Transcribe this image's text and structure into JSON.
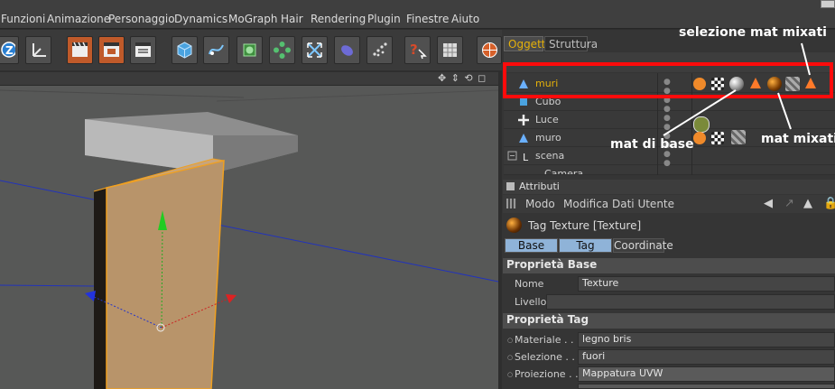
{
  "menu": {
    "items": [
      "Funzioni",
      "Animazione",
      "Personaggio",
      "Dynamics",
      "MoGraph",
      "Hair",
      "Rendering",
      "Plugin",
      "Finestre",
      "Aiuto"
    ]
  },
  "toolbar": {
    "icons": [
      "z-mode-icon",
      "axis-icon",
      "render-view-icon",
      "render-picture-icon",
      "render-settings-icon",
      "cube-icon",
      "spline-pen-icon",
      "nurbs-icon",
      "array-icon",
      "deformer-icon",
      "scene-icon",
      "particle-icon",
      "help-pointer-icon",
      "ruler-icon",
      "sphere-icon"
    ]
  },
  "object_manager": {
    "tabs": [
      "Oggetti",
      "Struttura"
    ],
    "rows": [
      {
        "name": "muri",
        "highlight": true
      },
      {
        "name": "Cubo",
        "highlight": false
      },
      {
        "name": "Luce",
        "highlight": false
      },
      {
        "name": "muro",
        "highlight": false
      },
      {
        "name": "scena",
        "highlight": false
      },
      {
        "name": "Camera",
        "highlight": false
      }
    ]
  },
  "attributes": {
    "header": "Attributi",
    "menu": [
      "Modo",
      "Modifica",
      "Dati Utente"
    ],
    "title": "Tag Texture [Texture]",
    "tabs": [
      "Base",
      "Tag",
      "Coordinate"
    ],
    "section_base": "Proprietà Base",
    "nome_label": "Nome",
    "nome_value": "Texture",
    "livello_label": "Livello",
    "section_tag": "Proprietà Tag",
    "materiale_label": "Materiale . . .",
    "materiale_value": "legno bris",
    "selezione_label": "Selezione . . .",
    "selezione_value": "fuori",
    "proiezione_label": "Proiezione . .",
    "proiezione_value": "Mappatura UVW"
  },
  "annotations": {
    "selezione": "selezione mat mixati",
    "base": "mat di base",
    "mixati": "mat mixati"
  },
  "colors": {
    "highlight_text": "#e5b10a",
    "annotation_box": "#ff0b0b",
    "selected_object": "#ff9900"
  }
}
